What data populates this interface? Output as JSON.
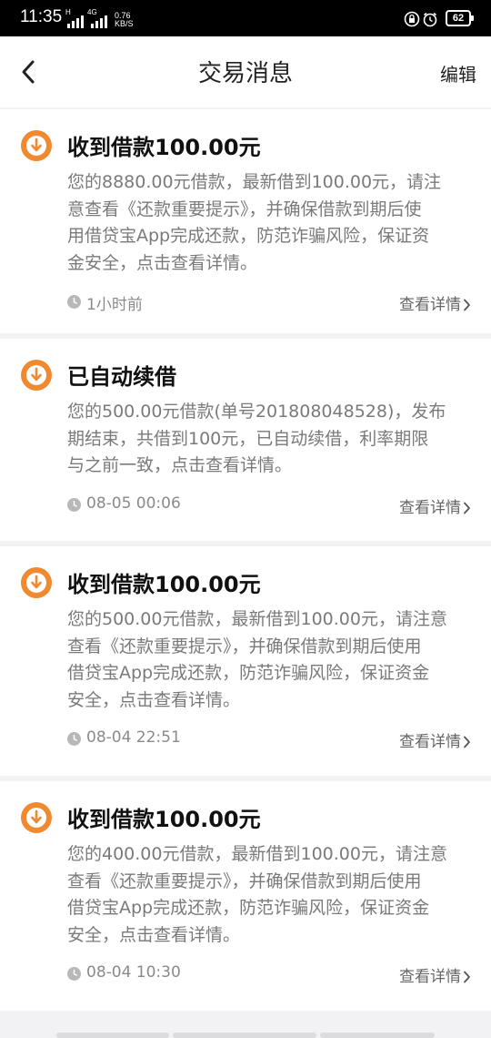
{
  "status_bar": {
    "time": "11:35",
    "net1": "H",
    "net2": "4G",
    "speed_value": "0.76",
    "speed_unit": "KB/S",
    "battery": "62"
  },
  "header": {
    "title": "交易消息",
    "edit_label": "编辑"
  },
  "colors": {
    "accent": "#f08a31",
    "divider": "#f2f2f4"
  },
  "messages": [
    {
      "icon": "download-icon",
      "title": "收到借款100.00元",
      "lines": [
        "您的8880.00元借款，最新借到100.00元，请注",
        "意查看《还款重要提示》，并确保借款到期后使",
        "用借贷宝App完成还款，防范诈骗风险，保证资",
        "金安全，点击查看详情。"
      ],
      "time": "1小时前",
      "detail_label": "查看详情"
    },
    {
      "icon": "download-icon",
      "title": "已自动续借",
      "lines": [
        "您的500.00元借款(单号201808048528)，发布",
        "期结束，共借到100元，已自动续借，利率期限",
        "与之前一致，点击查看详情。"
      ],
      "time": "08-05 00:06",
      "detail_label": "查看详情"
    },
    {
      "icon": "download-icon",
      "title": "收到借款100.00元",
      "lines": [
        "您的500.00元借款，最新借到100.00元，请注意",
        "查看《还款重要提示》，并确保借款到期后使用",
        "借贷宝App完成还款，防范诈骗风险，保证资金",
        "安全，点击查看详情。"
      ],
      "time": "08-04 22:51",
      "detail_label": "查看详情"
    },
    {
      "icon": "download-icon",
      "title": "收到借款100.00元",
      "lines": [
        "您的400.00元借款，最新借到100.00元，请注意",
        "查看《还款重要提示》，并确保借款到期后使用",
        "借贷宝App完成还款，防范诈骗风险，保证资金",
        "安全，点击查看详情。"
      ],
      "time": "08-04 10:30",
      "detail_label": "查看详情"
    }
  ]
}
